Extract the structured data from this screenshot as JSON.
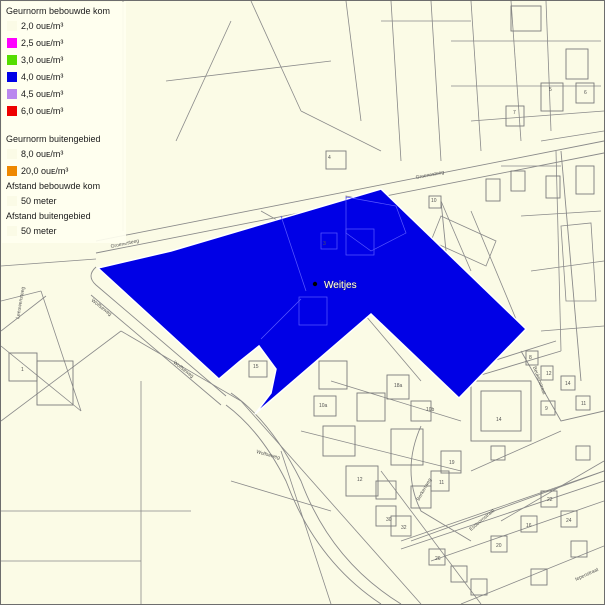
{
  "legend": {
    "sections": [
      {
        "heading": "Geurnorm bebouwde kom",
        "items": [
          {
            "label": "2,0 ouᴇ/m³",
            "color": "#fbfbe6"
          },
          {
            "label": "2,5 ouᴇ/m³",
            "color": "#ff00ff"
          },
          {
            "label": "3,0 ouᴇ/m³",
            "color": "#55dd00"
          },
          {
            "label": "4,0 ouᴇ/m³",
            "color": "#0000e6"
          },
          {
            "label": "4,5 ouᴇ/m³",
            "color": "#bb88ee"
          },
          {
            "label": "6,0 ouᴇ/m³",
            "color": "#ee0000"
          }
        ]
      },
      {
        "heading": "Geurnorm buitengebied",
        "items": [
          {
            "label": "8,0 ouᴇ/m³",
            "color": "#fbfbe6"
          },
          {
            "label": "20,0 ouᴇ/m³",
            "color": "#ee8800"
          }
        ]
      },
      {
        "heading": "Afstand bebouwde kom",
        "items": [
          {
            "label": "50 meter",
            "color": "#fbfbe6"
          }
        ]
      },
      {
        "heading": "Afstand buitengebied",
        "items": [
          {
            "label": "50 meter",
            "color": "#fbfbe6"
          }
        ]
      }
    ]
  },
  "map": {
    "place_name": "Weitjes",
    "zone_color": "#0000e6",
    "background_color": "#fbfbe6",
    "line_color": "#8a8a8a",
    "streets": [
      "Groenesteeg",
      "Groenesteeg",
      "Wolfseweg",
      "Wolfseweg",
      "Wolfseweg",
      "Esdoornstraat",
      "Beukenstraat",
      "Berkenweg",
      "Iepenstraat",
      "Leeuwensteeg"
    ],
    "house_numbers": [
      "4",
      "5",
      "7",
      "6",
      "3",
      "10",
      "15",
      "18a",
      "10b",
      "10a",
      "12",
      "1",
      "30",
      "32",
      "19",
      "11",
      "14",
      "22",
      "8",
      "12",
      "14",
      "9",
      "11",
      "16",
      "20",
      "24",
      "26"
    ]
  }
}
